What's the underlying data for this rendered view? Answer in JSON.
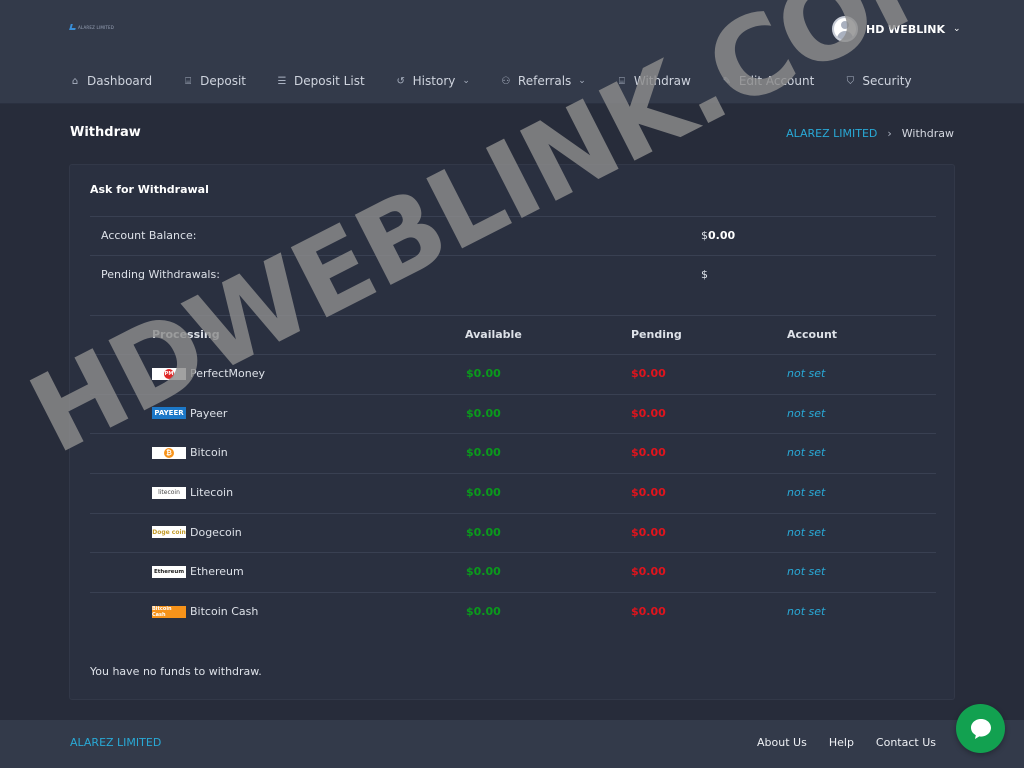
{
  "header": {
    "logo_text": "ALAREZ LIMITED",
    "user_name": "HD WEBLINK"
  },
  "nav": {
    "items": [
      {
        "label": "Dashboard",
        "icon": "home-icon"
      },
      {
        "label": "Deposit",
        "icon": "bank-icon"
      },
      {
        "label": "Deposit List",
        "icon": "list-icon"
      },
      {
        "label": "History",
        "icon": "history-icon",
        "dropdown": true
      },
      {
        "label": "Referrals",
        "icon": "users-icon",
        "dropdown": true
      },
      {
        "label": "Withdraw",
        "icon": "bank-icon"
      },
      {
        "label": "Edit Account",
        "icon": "user-edit-icon"
      },
      {
        "label": "Security",
        "icon": "shield-icon"
      }
    ]
  },
  "page": {
    "title": "Withdraw",
    "breadcrumb": {
      "home": "ALAREZ LIMITED",
      "sep": "›",
      "current": "Withdraw"
    }
  },
  "card": {
    "title": "Ask for Withdrawal",
    "balance_label": "Account Balance:",
    "balance_currency": "$",
    "balance_value": "0.00",
    "pending_label": "Pending Withdrawals:",
    "pending_value": "$",
    "table": {
      "headers": {
        "processing": "Processing",
        "available": "Available",
        "pending": "Pending",
        "account": "Account"
      },
      "rows": [
        {
          "name": "PerfectMoney",
          "icon_text": "PM",
          "available": "$0.00",
          "pending": "$0.00",
          "account": "not set"
        },
        {
          "name": "Payeer",
          "icon_text": "PAYEER",
          "available": "$0.00",
          "pending": "$0.00",
          "account": "not set"
        },
        {
          "name": "Bitcoin",
          "icon_text": "₿",
          "available": "$0.00",
          "pending": "$0.00",
          "account": "not set"
        },
        {
          "name": "Litecoin",
          "icon_text": "litecoin",
          "available": "$0.00",
          "pending": "$0.00",
          "account": "not set"
        },
        {
          "name": "Dogecoin",
          "icon_text": "Doge coin",
          "available": "$0.00",
          "pending": "$0.00",
          "account": "not set"
        },
        {
          "name": "Ethereum",
          "icon_text": "Ethereum",
          "available": "$0.00",
          "pending": "$0.00",
          "account": "not set"
        },
        {
          "name": "Bitcoin Cash",
          "icon_text": "Bitcoin Cash",
          "available": "$0.00",
          "pending": "$0.00",
          "account": "not set"
        }
      ]
    },
    "no_funds": "You have no funds to withdraw."
  },
  "footer": {
    "brand": "ALAREZ LIMITED",
    "links": [
      "About Us",
      "Help",
      "Contact Us"
    ]
  },
  "watermark": "HDWEBLINK.COM",
  "colors": {
    "accent": "#29a9d6",
    "available": "#0a9a1c",
    "pending": "#e0141d",
    "chat": "#12a150"
  }
}
